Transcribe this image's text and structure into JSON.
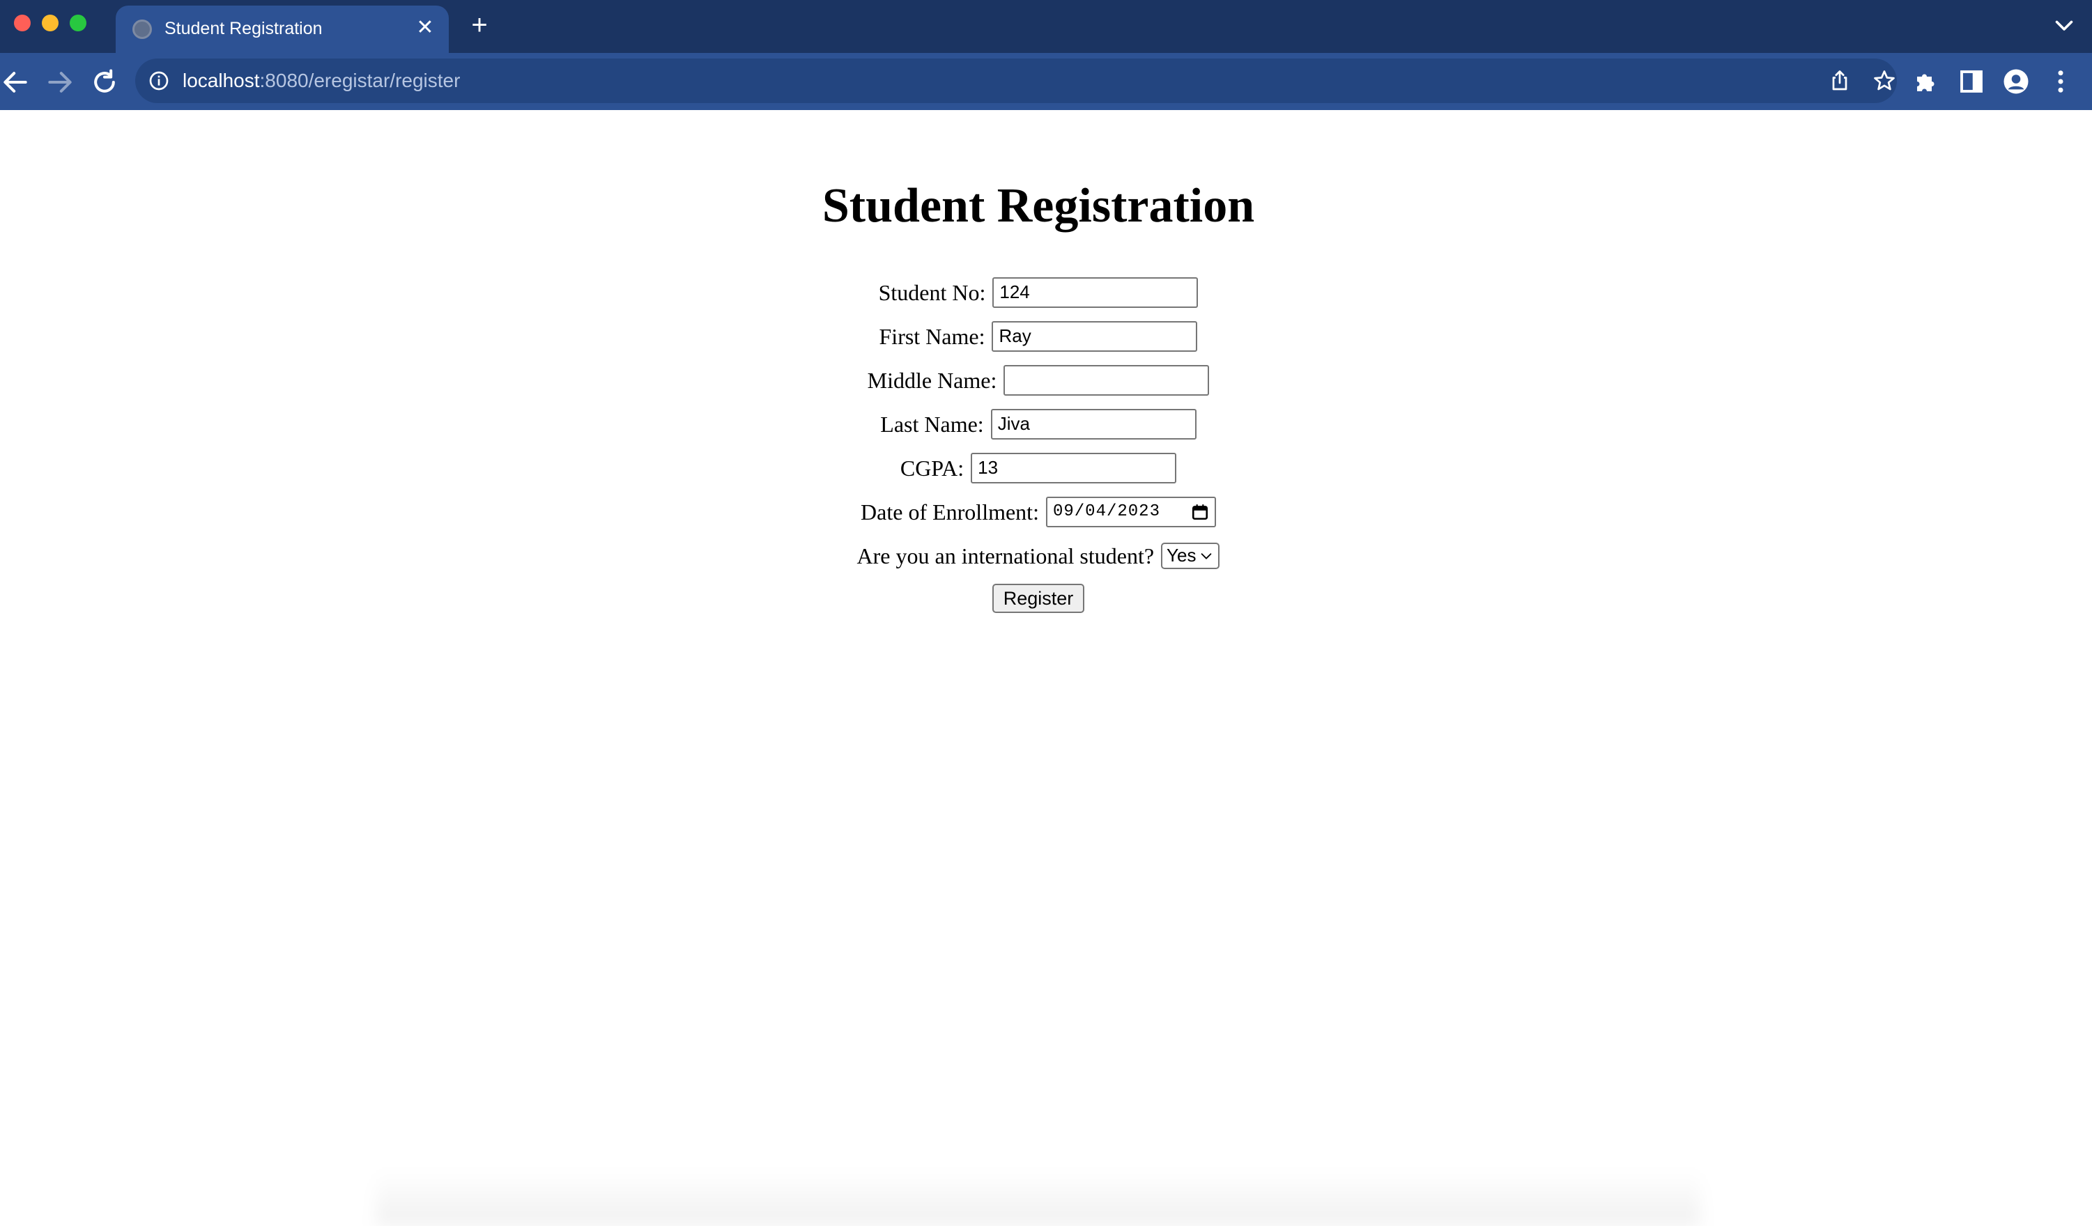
{
  "browser": {
    "tab": {
      "title": "Student Registration",
      "close_glyph": "✕",
      "favicon_icon": "globe-icon"
    },
    "new_tab_glyph": "+",
    "address_bar": {
      "host": "localhost",
      "path": ":8080/eregistar/register",
      "info_icon": "info-icon"
    },
    "icons": {
      "back": "back-arrow-icon",
      "forward": "forward-arrow-icon",
      "reload": "reload-icon",
      "share": "share-icon",
      "bookmark": "star-icon",
      "extensions": "puzzle-icon",
      "side_panel": "side-panel-icon",
      "profile": "profile-icon",
      "menu": "kebab-menu-icon",
      "tab_search": "chevron-down-icon"
    },
    "colors": {
      "titlebar": "#1b3462",
      "toolbar": "#2d5294",
      "omnibox": "#234580"
    }
  },
  "page": {
    "title": "Student Registration",
    "form": {
      "student_no": {
        "label": "Student No:",
        "value": "124"
      },
      "first_name": {
        "label": "First Name:",
        "value": "Ray"
      },
      "middle_name": {
        "label": "Middle Name:",
        "value": ""
      },
      "last_name": {
        "label": "Last Name:",
        "value": "Jiva"
      },
      "cgpa": {
        "label": "CGPA:",
        "value": "13"
      },
      "enrollment_date": {
        "label": "Date of Enrollment:",
        "value": "09/04/2023",
        "icon": "calendar-icon"
      },
      "international": {
        "label": "Are you an international student?",
        "selected": "Yes"
      },
      "submit_label": "Register"
    }
  }
}
